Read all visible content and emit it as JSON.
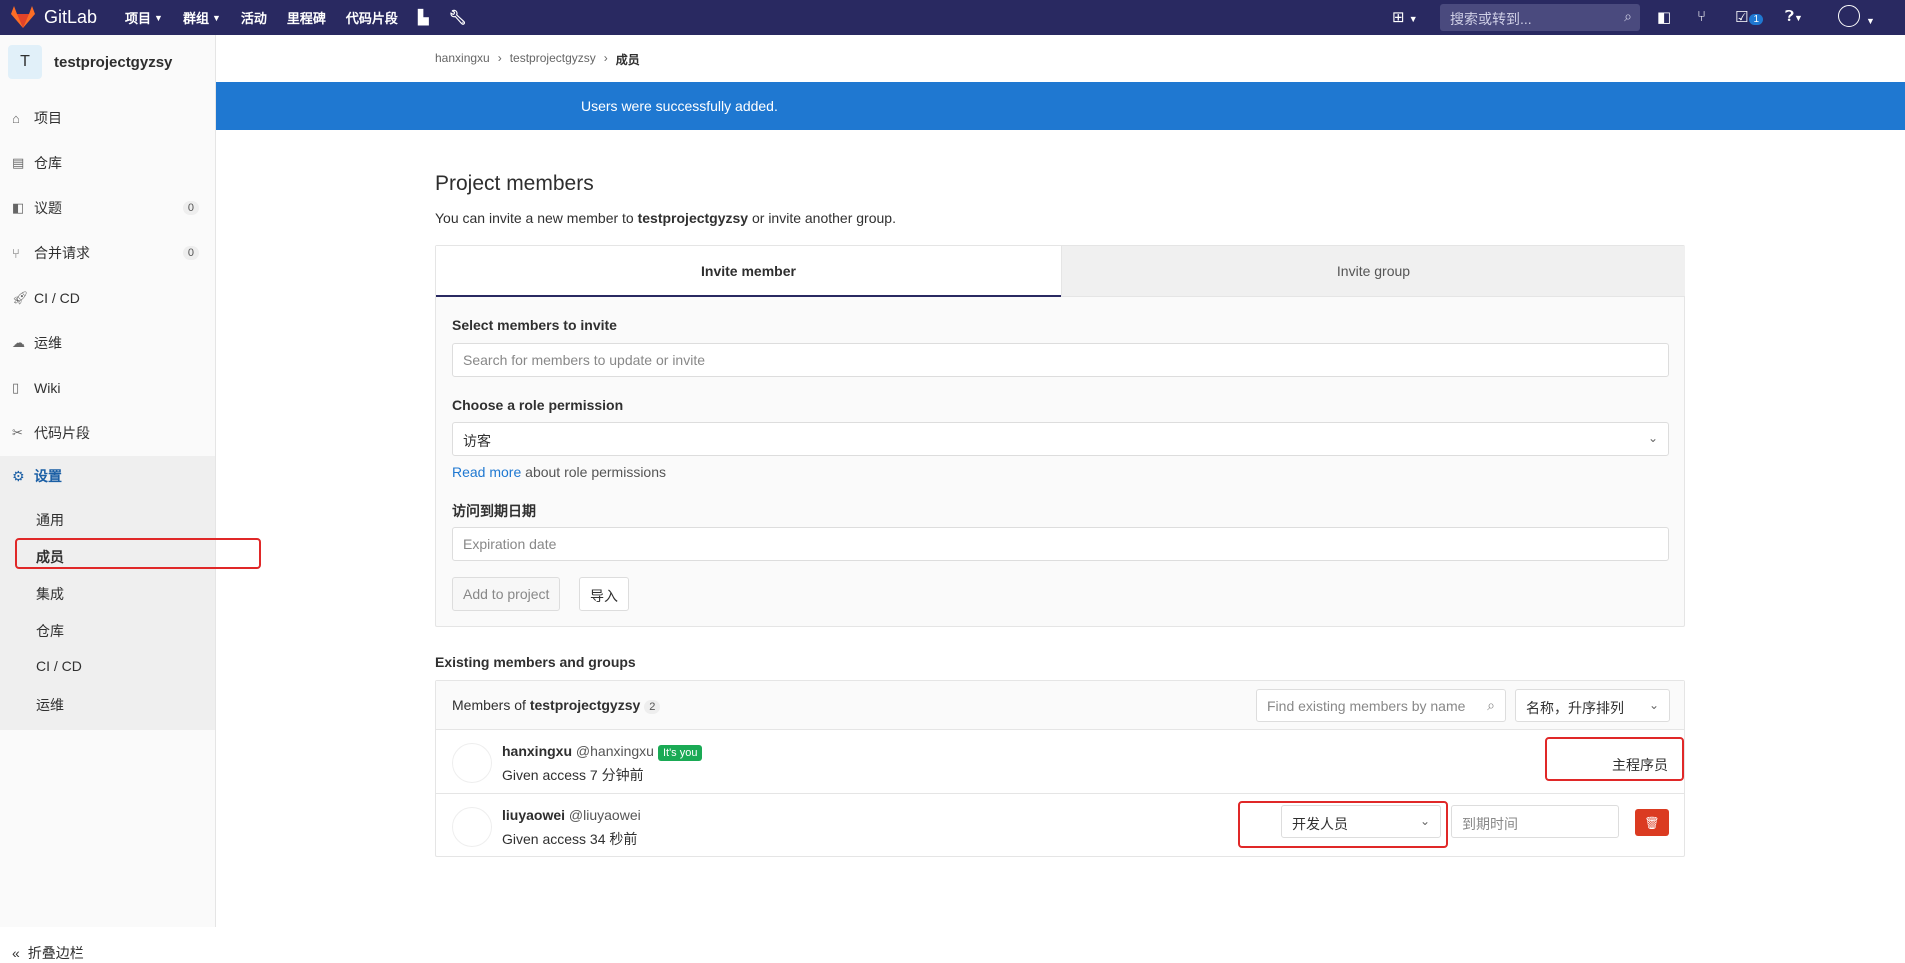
{
  "topbar": {
    "logo_text": "GitLab",
    "nav": [
      "项目",
      "群组",
      "活动",
      "里程碑",
      "代码片段"
    ],
    "search_placeholder": "搜索或转到...",
    "todo_count": "1"
  },
  "sidebar": {
    "project_initial": "T",
    "project_name": "testprojectgyzsy",
    "items": [
      {
        "label": "项目"
      },
      {
        "label": "仓库"
      },
      {
        "label": "议题",
        "count": "0"
      },
      {
        "label": "合并请求",
        "count": "0"
      },
      {
        "label": "CI / CD"
      },
      {
        "label": "运维"
      },
      {
        "label": "Wiki"
      },
      {
        "label": "代码片段"
      }
    ],
    "settings_label": "设置",
    "settings_sub": [
      "通用",
      "成员",
      "集成",
      "仓库",
      "CI / CD",
      "运维"
    ],
    "collapse_label": "折叠边栏"
  },
  "breadcrumb": [
    "hanxingxu",
    "testprojectgyzsy",
    "成员"
  ],
  "flash": "Users were successfully added.",
  "page": {
    "title": "Project members",
    "subtitle_pre": "You can invite a new member to ",
    "subtitle_project": "testprojectgyzsy",
    "subtitle_post": " or invite another group."
  },
  "invite": {
    "tab_member": "Invite member",
    "tab_group": "Invite group",
    "select_label": "Select members to invite",
    "search_placeholder": "Search for members to update or invite",
    "role_label": "Choose a role permission",
    "role_value": "访客",
    "read_more": "Read more",
    "read_more_suffix": " about role permissions",
    "expire_label": "访问到期日期",
    "expire_placeholder": "Expiration date",
    "add_button": "Add to project",
    "import_button": "导入"
  },
  "existing": {
    "section_title": "Existing members and groups",
    "members_of": "Members of ",
    "project": "testprojectgyzsy",
    "count": "2",
    "search_placeholder": "Find existing members by name",
    "sort": "名称，升序排列",
    "rows": [
      {
        "name": "hanxingxu",
        "handle": "@hanxingxu",
        "badge": "It's you",
        "access": "Given access 7 分钟前",
        "role": "主程序员"
      },
      {
        "name": "liuyaowei",
        "handle": "@liuyaowei",
        "access": "Given access 34 秒前",
        "role": "开发人员",
        "expire_placeholder": "到期时间"
      }
    ]
  },
  "colors": {
    "navbar": "#292961",
    "flash": "#1f78d1",
    "highlight": "#e02828",
    "delete": "#db3b21",
    "you_badge": "#1aaa55"
  }
}
